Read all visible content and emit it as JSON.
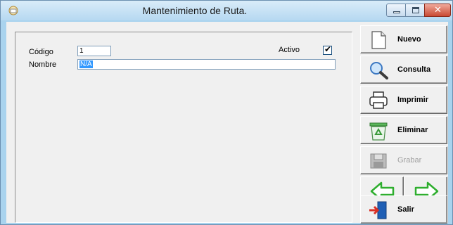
{
  "window": {
    "title": "Mantenimiento de Ruta."
  },
  "form": {
    "codigo_label": "Código",
    "codigo_value": "1",
    "nombre_label": "Nombre",
    "nombre_value": "N/A",
    "activo_label": "Activo",
    "activo_checked": true
  },
  "toolbar": {
    "nuevo": "Nuevo",
    "consulta": "Consulta",
    "imprimir": "Imprimir",
    "eliminar": "Eliminar",
    "grabar": "Grabar",
    "salir": "Salir"
  },
  "icons": {
    "new": "new-document-icon",
    "search": "magnifier-icon",
    "print": "printer-icon",
    "delete": "recycle-bin-icon",
    "save": "floppy-disk-icon",
    "prev": "arrow-left-icon",
    "next": "arrow-right-icon",
    "exit": "exit-door-icon"
  },
  "colors": {
    "title_bar": "#b6d8f1",
    "selection": "#3399ff",
    "arrow_green": "#3ec43e",
    "close_red": "#c94a34"
  }
}
